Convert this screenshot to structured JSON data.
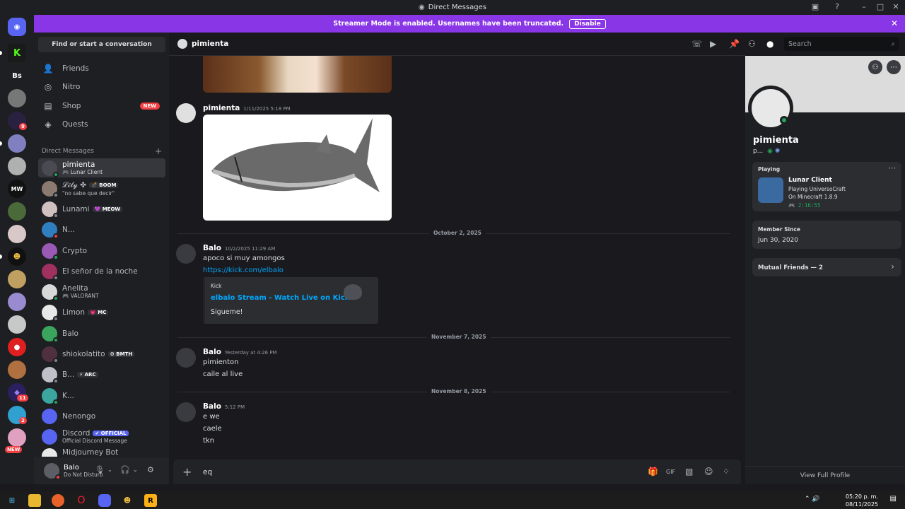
{
  "window": {
    "title": "Direct Messages"
  },
  "banner": {
    "text": "Streamer Mode is enabled. Usernames have been truncated.",
    "button": "Disable"
  },
  "servers": {
    "bs_label": "Bs",
    "badges": [
      "9",
      "11",
      "2"
    ],
    "new_label": "NEW"
  },
  "sidebar": {
    "find_label": "Find or start a conversation",
    "nav": [
      {
        "label": "Friends",
        "icon": "friends-icon"
      },
      {
        "label": "Nitro",
        "icon": "nitro-icon"
      },
      {
        "label": "Shop",
        "icon": "shop-icon",
        "badge": "NEW"
      },
      {
        "label": "Quests",
        "icon": "quests-icon"
      }
    ],
    "dm_header": "Direct Messages",
    "dms": [
      {
        "name": "pimienta",
        "sub": "Lunar Client",
        "status": "online",
        "color": "#4a4a52"
      },
      {
        "name": "𝓛𝓲𝓵𝔂 ✤",
        "tag": "💣 BOOM",
        "sub": "\"no sabe que decir\"",
        "status": "off",
        "color": "#8a7a70"
      },
      {
        "name": "Lunami",
        "tag": "💜 MEOW",
        "status": "off",
        "color": "#e0d0d0"
      },
      {
        "name": "N...",
        "status": "dnd",
        "color": "#2f7fc0"
      },
      {
        "name": "Crypto",
        "status": "online",
        "color": "#9b59b6"
      },
      {
        "name": "El señor de la noche",
        "status": "off",
        "color": "#a03060"
      },
      {
        "name": "Anelita",
        "sub": "VALORANT",
        "status": "online",
        "color": "#d8d8d8"
      },
      {
        "name": "Limon",
        "tag": "💗 MC",
        "status": "off",
        "color": "#e8e8e8"
      },
      {
        "name": "Balo",
        "status": "online",
        "color": "#3ba55d"
      },
      {
        "name": "shiokolatito",
        "tag": "⚙ BMTH",
        "status": "off",
        "color": "#503040"
      },
      {
        "name": "B...",
        "tag": "⚡ ARC",
        "status": "off",
        "color": "#c0c0c8"
      },
      {
        "name": "K...",
        "status": "online",
        "color": "#3ba5a0"
      },
      {
        "name": "Nenongo",
        "status": "none",
        "color": "#5865f2"
      },
      {
        "name": "Discord",
        "tag": "✔ OFFICIAL",
        "sub": "Official Discord Message",
        "status": "none",
        "color": "#5865f2"
      },
      {
        "name": "Midjourney Bot",
        "status": "none",
        "color": "#e8e8e8"
      }
    ],
    "user": {
      "name": "Balo",
      "status": "Do Not Disturb"
    }
  },
  "chat": {
    "header_name": "pimienta",
    "search_placeholder": "Search",
    "messages": [
      {
        "author": "pimienta",
        "time": "1/11/2025 5:18 PM"
      },
      {
        "date": "October 2, 2025"
      },
      {
        "author": "Balo",
        "time": "10/2/2025 11:29 AM",
        "lines": [
          "apoco si muy amongos"
        ],
        "link": "https://kick.com/elbalo",
        "embed": {
          "provider": "Kick",
          "title": "elbalo Stream - Watch Live on Kick",
          "desc": "Sigueme!"
        }
      },
      {
        "date": "November 7, 2025"
      },
      {
        "author": "Balo",
        "time": "Yesterday at 4:26 PM",
        "lines": [
          "pimienton",
          "caile al live"
        ]
      },
      {
        "date": "November 8, 2025"
      },
      {
        "author": "Balo",
        "time": "5:12 PM",
        "lines": [
          "e we",
          "caele",
          "tkn"
        ]
      }
    ],
    "input_value": "eq"
  },
  "profile": {
    "name": "pimienta",
    "sub": "p...",
    "activity_header": "Playing",
    "game": "Lunar Client",
    "game_detail1": "Playing UniversoCraft",
    "game_detail2": "On Minecraft 1.8.9",
    "elapsed": "2:16:55",
    "member_since_label": "Member Since",
    "member_since": "Jun 30, 2020",
    "mutual": "Mutual Friends — 2",
    "view_full": "View Full Profile"
  },
  "taskbar": {
    "time": "05:20 p. m.",
    "date": "08/11/2025"
  }
}
